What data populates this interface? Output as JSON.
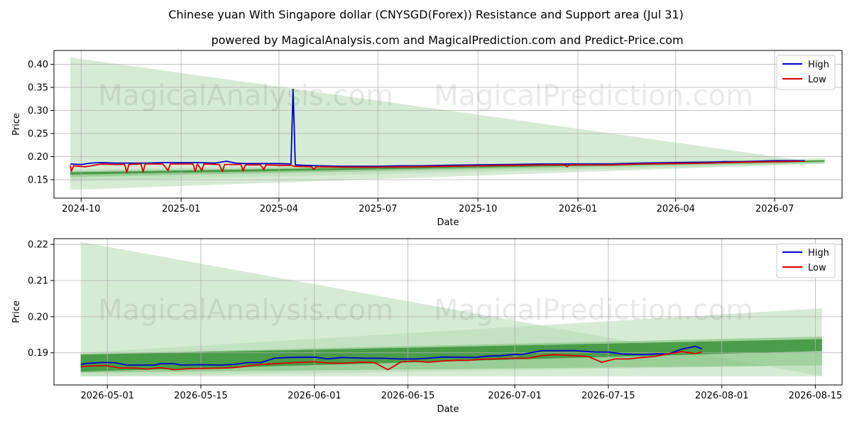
{
  "title": "Chinese yuan With Singapore dollar (CNYSGD(Forex)) Resistance and Support area (Jul 31)",
  "subtitle": "powered by MagicalAnalysis.com and MagicalPrediction.com and Predict-Price.com",
  "watermarks": [
    "MagicalAnalysis.com",
    "MagicalPrediction.com"
  ],
  "colors": {
    "high": "#0000cc",
    "low": "#dd0000",
    "band_light": "#b5dbb0",
    "band_mid": "#7fc17a",
    "band_dark": "#2e8b2e",
    "grid": "#b0b0b0"
  },
  "chart_data": [
    {
      "type": "line",
      "xlabel": "Date",
      "ylabel": "Price",
      "x_ticks": [
        "2024-10",
        "2025-01",
        "2025-04",
        "2025-07",
        "2025-10",
        "2026-01",
        "2026-04",
        "2026-07"
      ],
      "y_ticks": [
        "0.15",
        "0.20",
        "0.25",
        "0.30",
        "0.35",
        "0.40"
      ],
      "xlim": [
        "2024-09-06",
        "2026-09-01"
      ],
      "ylim": [
        0.11,
        0.43
      ],
      "grid": true,
      "legend": "top-right",
      "bands": [
        {
          "shade": "light",
          "start": "2024-09-21",
          "end": "2026-08-16",
          "upper": [
            0.415,
            0.185
          ],
          "lower": [
            0.128,
            0.185
          ]
        },
        {
          "shade": "light",
          "start": "2024-09-21",
          "end": "2026-08-16",
          "upper": [
            0.172,
            0.196
          ],
          "lower": [
            0.147,
            0.184
          ]
        },
        {
          "shade": "mid",
          "start": "2024-09-21",
          "end": "2026-08-16",
          "upper": [
            0.168,
            0.193
          ],
          "lower": [
            0.156,
            0.187
          ]
        },
        {
          "shade": "dark",
          "start": "2024-09-21",
          "end": "2026-08-16",
          "upper": [
            0.166,
            0.192
          ],
          "lower": [
            0.161,
            0.189
          ]
        }
      ],
      "series": [
        {
          "name": "High",
          "color": "#0000cc",
          "points": [
            [
              "2024-09-21",
              0.184
            ],
            [
              "2024-10-01",
              0.183
            ],
            [
              "2024-10-10",
              0.186
            ],
            [
              "2024-10-20",
              0.187
            ],
            [
              "2024-11-01",
              0.186
            ],
            [
              "2024-11-15",
              0.186
            ],
            [
              "2024-12-01",
              0.186
            ],
            [
              "2024-12-15",
              0.187
            ],
            [
              "2025-01-01",
              0.187
            ],
            [
              "2025-01-15",
              0.187
            ],
            [
              "2025-02-01",
              0.186
            ],
            [
              "2025-02-12",
              0.19
            ],
            [
              "2025-02-20",
              0.186
            ],
            [
              "2025-03-01",
              0.185
            ],
            [
              "2025-03-15",
              0.185
            ],
            [
              "2025-04-01",
              0.185
            ],
            [
              "2025-04-12",
              0.184
            ],
            [
              "2025-04-14",
              0.346
            ],
            [
              "2025-04-16",
              0.182
            ],
            [
              "2025-04-25",
              0.181
            ],
            [
              "2025-05-10",
              0.18
            ],
            [
              "2025-06-01",
              0.179
            ],
            [
              "2025-06-20",
              0.179
            ],
            [
              "2025-07-01",
              0.179
            ],
            [
              "2025-07-20",
              0.18
            ],
            [
              "2025-08-10",
              0.18
            ],
            [
              "2025-09-01",
              0.181
            ],
            [
              "2025-10-01",
              0.182
            ],
            [
              "2025-11-01",
              0.183
            ],
            [
              "2025-12-01",
              0.184
            ],
            [
              "2026-01-01",
              0.184
            ],
            [
              "2026-02-01",
              0.184
            ],
            [
              "2026-03-01",
              0.186
            ],
            [
              "2026-04-01",
              0.187
            ],
            [
              "2026-05-01",
              0.188
            ],
            [
              "2026-05-15",
              0.189
            ],
            [
              "2026-06-01",
              0.189
            ],
            [
              "2026-06-15",
              0.19
            ],
            [
              "2026-07-01",
              0.191
            ],
            [
              "2026-07-29",
              0.191
            ]
          ]
        },
        {
          "name": "Low",
          "color": "#dd0000",
          "points": [
            [
              "2024-09-21",
              0.181
            ],
            [
              "2024-09-22",
              0.168
            ],
            [
              "2024-09-24",
              0.18
            ],
            [
              "2024-10-05",
              0.178
            ],
            [
              "2024-10-20",
              0.184
            ],
            [
              "2024-11-01",
              0.183
            ],
            [
              "2024-11-10",
              0.183
            ],
            [
              "2024-11-12",
              0.166
            ],
            [
              "2024-11-14",
              0.183
            ],
            [
              "2024-11-25",
              0.184
            ],
            [
              "2024-11-27",
              0.167
            ],
            [
              "2024-11-29",
              0.184
            ],
            [
              "2024-12-15",
              0.184
            ],
            [
              "2024-12-20",
              0.17
            ],
            [
              "2024-12-22",
              0.184
            ],
            [
              "2025-01-01",
              0.184
            ],
            [
              "2025-01-12",
              0.184
            ],
            [
              "2025-01-14",
              0.168
            ],
            [
              "2025-01-16",
              0.184
            ],
            [
              "2025-01-20",
              0.17
            ],
            [
              "2025-01-22",
              0.184
            ],
            [
              "2025-02-05",
              0.183
            ],
            [
              "2025-02-08",
              0.168
            ],
            [
              "2025-02-10",
              0.183
            ],
            [
              "2025-02-25",
              0.183
            ],
            [
              "2025-02-27",
              0.169
            ],
            [
              "2025-03-01",
              0.182
            ],
            [
              "2025-03-15",
              0.182
            ],
            [
              "2025-03-18",
              0.172
            ],
            [
              "2025-03-20",
              0.182
            ],
            [
              "2025-04-01",
              0.181
            ],
            [
              "2025-04-12",
              0.181
            ],
            [
              "2025-04-15",
              0.179
            ],
            [
              "2025-05-01",
              0.178
            ],
            [
              "2025-05-03",
              0.172
            ],
            [
              "2025-05-05",
              0.178
            ],
            [
              "2025-06-01",
              0.177
            ],
            [
              "2025-07-01",
              0.177
            ],
            [
              "2025-08-01",
              0.178
            ],
            [
              "2025-09-01",
              0.179
            ],
            [
              "2025-10-01",
              0.18
            ],
            [
              "2025-11-01",
              0.181
            ],
            [
              "2025-12-01",
              0.182
            ],
            [
              "2025-12-20",
              0.182
            ],
            [
              "2025-12-22",
              0.178
            ],
            [
              "2025-12-24",
              0.182
            ],
            [
              "2026-01-15",
              0.182
            ],
            [
              "2026-02-01",
              0.182
            ],
            [
              "2026-03-01",
              0.184
            ],
            [
              "2026-04-01",
              0.185
            ],
            [
              "2026-05-01",
              0.186
            ],
            [
              "2026-06-01",
              0.188
            ],
            [
              "2026-07-01",
              0.189
            ],
            [
              "2026-07-29",
              0.19
            ]
          ]
        }
      ]
    },
    {
      "type": "line",
      "xlabel": "Date",
      "ylabel": "Price",
      "x_ticks": [
        "2026-05-01",
        "2026-05-15",
        "2026-06-01",
        "2026-06-15",
        "2026-07-01",
        "2026-07-15",
        "2026-08-01",
        "2026-08-15"
      ],
      "y_ticks": [
        "0.19",
        "0.20",
        "0.21",
        "0.22"
      ],
      "xlim": [
        "2026-04-23",
        "2026-08-19"
      ],
      "ylim": [
        0.1811,
        0.2216
      ],
      "grid": true,
      "legend": "top-right",
      "bands": [
        {
          "shade": "light",
          "start": "2026-04-27",
          "end": "2026-08-16",
          "upper": [
            0.2207,
            0.1835
          ],
          "lower": [
            0.1834,
            0.1865
          ]
        },
        {
          "shade": "light",
          "start": "2026-04-27",
          "end": "2026-08-16",
          "upper": [
            0.19,
            0.2023
          ],
          "lower": [
            0.1835,
            0.1835
          ]
        },
        {
          "shade": "mid",
          "start": "2026-04-27",
          "end": "2026-08-16",
          "upper": [
            0.1897,
            0.1945
          ],
          "lower": [
            0.1845,
            0.1865
          ]
        },
        {
          "shade": "dark",
          "start": "2026-04-27",
          "end": "2026-08-16",
          "upper": [
            0.1895,
            0.1938
          ],
          "lower": [
            0.1848,
            0.1905
          ]
        }
      ],
      "series": [
        {
          "name": "High",
          "color": "#0000cc",
          "points": [
            [
              "2026-04-27",
              0.1868
            ],
            [
              "2026-04-28",
              0.1871
            ],
            [
              "2026-04-30",
              0.1873
            ],
            [
              "2026-05-02",
              0.1873
            ],
            [
              "2026-05-04",
              0.1866
            ],
            [
              "2026-05-06",
              0.1866
            ],
            [
              "2026-05-08",
              0.1866
            ],
            [
              "2026-05-09",
              0.187
            ],
            [
              "2026-05-11",
              0.187
            ],
            [
              "2026-05-12",
              0.1866
            ],
            [
              "2026-05-15",
              0.1867
            ],
            [
              "2026-05-18",
              0.1866
            ],
            [
              "2026-05-20",
              0.1868
            ],
            [
              "2026-05-22",
              0.1873
            ],
            [
              "2026-05-24",
              0.1873
            ],
            [
              "2026-05-26",
              0.1885
            ],
            [
              "2026-05-28",
              0.1887
            ],
            [
              "2026-06-01",
              0.1888
            ],
            [
              "2026-06-03",
              0.1883
            ],
            [
              "2026-06-05",
              0.1887
            ],
            [
              "2026-06-07",
              0.1886
            ],
            [
              "2026-06-09",
              0.1885
            ],
            [
              "2026-06-11",
              0.1885
            ],
            [
              "2026-06-14",
              0.1883
            ],
            [
              "2026-06-16",
              0.1883
            ],
            [
              "2026-06-18",
              0.1885
            ],
            [
              "2026-06-20",
              0.1888
            ],
            [
              "2026-06-22",
              0.1888
            ],
            [
              "2026-06-25",
              0.1887
            ],
            [
              "2026-06-27",
              0.1891
            ],
            [
              "2026-06-29",
              0.1892
            ],
            [
              "2026-07-01",
              0.1896
            ],
            [
              "2026-07-02",
              0.1895
            ],
            [
              "2026-07-05",
              0.1906
            ],
            [
              "2026-07-08",
              0.1906
            ],
            [
              "2026-07-10",
              0.1906
            ],
            [
              "2026-07-13",
              0.1902
            ],
            [
              "2026-07-15",
              0.1902
            ],
            [
              "2026-07-17",
              0.1897
            ],
            [
              "2026-07-20",
              0.1895
            ],
            [
              "2026-07-22",
              0.1897
            ],
            [
              "2026-07-24",
              0.1897
            ],
            [
              "2026-07-26",
              0.191
            ],
            [
              "2026-07-28",
              0.1918
            ],
            [
              "2026-07-29",
              0.1911
            ]
          ]
        },
        {
          "name": "Low",
          "color": "#dd0000",
          "points": [
            [
              "2026-04-27",
              0.1862
            ],
            [
              "2026-04-29",
              0.1864
            ],
            [
              "2026-05-01",
              0.1864
            ],
            [
              "2026-05-03",
              0.1858
            ],
            [
              "2026-05-05",
              0.1858
            ],
            [
              "2026-05-07",
              0.1855
            ],
            [
              "2026-05-09",
              0.1859
            ],
            [
              "2026-05-11",
              0.1853
            ],
            [
              "2026-05-13",
              0.1856
            ],
            [
              "2026-05-16",
              0.1857
            ],
            [
              "2026-05-19",
              0.1858
            ],
            [
              "2026-05-21",
              0.1861
            ],
            [
              "2026-05-23",
              0.1866
            ],
            [
              "2026-05-26",
              0.187
            ],
            [
              "2026-05-29",
              0.1873
            ],
            [
              "2026-06-01",
              0.1875
            ],
            [
              "2026-06-03",
              0.1872
            ],
            [
              "2026-06-05",
              0.1871
            ],
            [
              "2026-06-08",
              0.1874
            ],
            [
              "2026-06-10",
              0.1873
            ],
            [
              "2026-06-12",
              0.1853
            ],
            [
              "2026-06-14",
              0.1875
            ],
            [
              "2026-06-16",
              0.1877
            ],
            [
              "2026-06-18",
              0.1874
            ],
            [
              "2026-06-20",
              0.1877
            ],
            [
              "2026-06-22",
              0.1879
            ],
            [
              "2026-06-24",
              0.1879
            ],
            [
              "2026-06-26",
              0.1882
            ],
            [
              "2026-06-28",
              0.1883
            ],
            [
              "2026-07-01",
              0.1885
            ],
            [
              "2026-07-03",
              0.1885
            ],
            [
              "2026-07-05",
              0.1892
            ],
            [
              "2026-07-07",
              0.1895
            ],
            [
              "2026-07-09",
              0.1893
            ],
            [
              "2026-07-12",
              0.189
            ],
            [
              "2026-07-14",
              0.1874
            ],
            [
              "2026-07-16",
              0.1883
            ],
            [
              "2026-07-18",
              0.1883
            ],
            [
              "2026-07-20",
              0.1887
            ],
            [
              "2026-07-22",
              0.189
            ],
            [
              "2026-07-24",
              0.1897
            ],
            [
              "2026-07-26",
              0.1903
            ],
            [
              "2026-07-28",
              0.1898
            ],
            [
              "2026-07-29",
              0.1902
            ]
          ]
        }
      ]
    }
  ]
}
